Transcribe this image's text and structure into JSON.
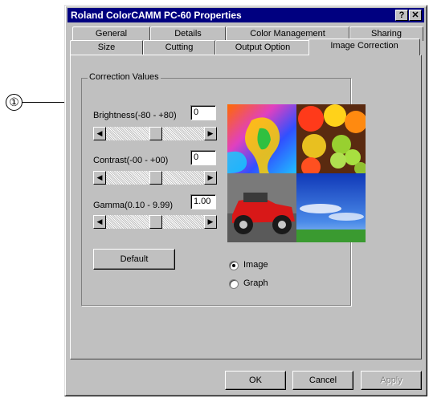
{
  "callout": {
    "number": "①"
  },
  "window": {
    "title": "Roland ColorCAMM PC-60 Properties",
    "help_button": "?",
    "close_button": "✕"
  },
  "tabs": {
    "row1": [
      "General",
      "Details",
      "Color Management",
      "Sharing"
    ],
    "row2": [
      "Size",
      "Cutting",
      "Output Option",
      "Image Correction"
    ],
    "active": "Image Correction"
  },
  "correction": {
    "group_label": "Correction Values",
    "brightness": {
      "label": "Brightness(-80 - +80)",
      "value": "0"
    },
    "contrast": {
      "label": "Contrast(-00 - +00)",
      "value": "0"
    },
    "gamma": {
      "label": "Gamma(0.10 - 9.99)",
      "value": "1.00"
    },
    "default_button": "Default"
  },
  "preview_mode": {
    "options": [
      "Image",
      "Graph"
    ],
    "selected": "Image"
  },
  "footer": {
    "ok": "OK",
    "cancel": "Cancel",
    "apply": "Apply"
  },
  "icons": {
    "left_arrow": "◀",
    "right_arrow": "▶"
  }
}
